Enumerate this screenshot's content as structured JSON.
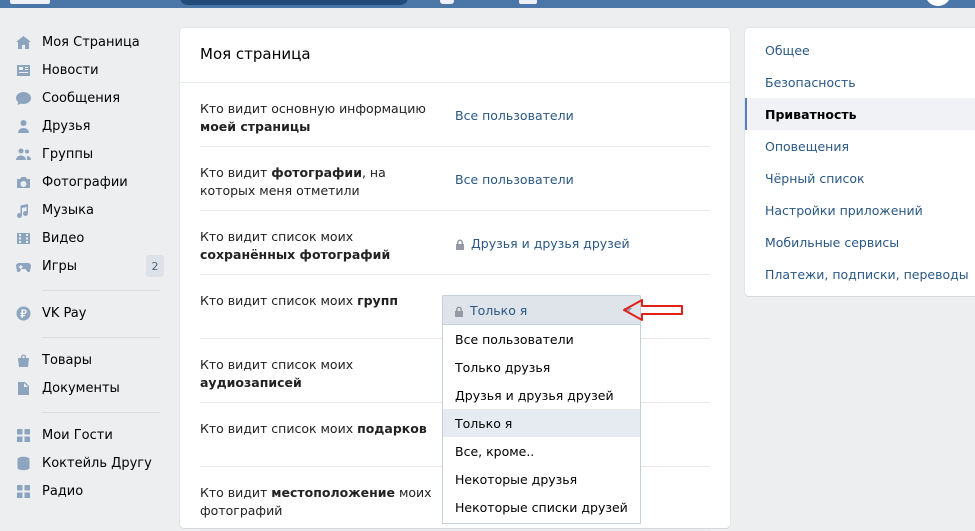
{
  "left_nav": {
    "items": [
      {
        "label": "Моя Страница",
        "icon": "home-icon"
      },
      {
        "label": "Новости",
        "icon": "news-icon"
      },
      {
        "label": "Сообщения",
        "icon": "messages-icon"
      },
      {
        "label": "Друзья",
        "icon": "friends-icon"
      },
      {
        "label": "Группы",
        "icon": "groups-icon"
      },
      {
        "label": "Фотографии",
        "icon": "camera-icon"
      },
      {
        "label": "Музыка",
        "icon": "music-icon"
      },
      {
        "label": "Видео",
        "icon": "video-icon"
      },
      {
        "label": "Игры",
        "icon": "games-icon",
        "count": "2"
      }
    ],
    "group2": [
      {
        "label": "VK Pay",
        "icon": "vkpay-icon"
      }
    ],
    "group3": [
      {
        "label": "Товары",
        "icon": "goods-icon"
      },
      {
        "label": "Документы",
        "icon": "documents-icon"
      }
    ],
    "group4": [
      {
        "label": "Мои Гости",
        "icon": "apps-icon"
      },
      {
        "label": "Коктейль Другу",
        "icon": "cocktail-icon"
      },
      {
        "label": "Радио",
        "icon": "apps-icon"
      }
    ]
  },
  "panel": {
    "title": "Моя страница",
    "rows": [
      {
        "pre": "Кто видит основную информацию ",
        "bold": "моей страницы",
        "post": "",
        "value": "Все пользователи",
        "locked": false
      },
      {
        "pre": "Кто видит ",
        "bold": "фотографии",
        "post": ", на которых меня отметили",
        "value": "Все пользователи",
        "locked": false
      },
      {
        "pre": "Кто видит список моих ",
        "bold": "сохранённых фотографий",
        "post": "",
        "value": "Друзья и друзья друзей",
        "locked": true
      },
      {
        "pre": "Кто видит список моих ",
        "bold": "групп",
        "post": "",
        "value": "",
        "locked": false
      },
      {
        "pre": "Кто видит список моих ",
        "bold": "аудиозаписей",
        "post": "",
        "value": "",
        "locked": false
      },
      {
        "pre": "Кто видит список моих ",
        "bold": "подарков",
        "post": "",
        "value": "",
        "locked": false
      },
      {
        "pre": "Кто видит ",
        "bold": "местоположение",
        "post": " моих фотографий",
        "value": "",
        "locked": false
      }
    ]
  },
  "dropdown": {
    "current": "Только я",
    "options": [
      "Все пользователи",
      "Только друзья",
      "Друзья и друзья друзей",
      "Только я",
      "Все, кроме..",
      "Некоторые друзья",
      "Некоторые списки друзей"
    ],
    "selected_index": 3
  },
  "right_nav": {
    "items": [
      "Общее",
      "Безопасность",
      "Приватность",
      "Оповещения",
      "Чёрный список",
      "Настройки приложений",
      "Мобильные сервисы",
      "Платежи, подписки, переводы"
    ],
    "active_index": 2
  },
  "colors": {
    "accent": "#4a76a8",
    "link": "#2a5885",
    "annotation": "#e0201b"
  }
}
